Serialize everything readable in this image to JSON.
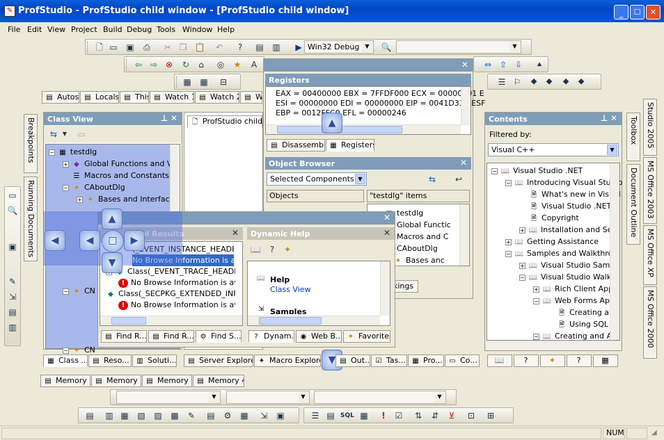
{
  "window": {
    "title": "ProfStudio - ProfStudio child window - [ProfStudio child window]",
    "controls": [
      "minimize",
      "maximize",
      "close"
    ]
  },
  "menubar": [
    "File",
    "Edit",
    "View",
    "Project",
    "Build",
    "Debug",
    "Tools",
    "Window",
    "Help"
  ],
  "toolbar": {
    "config": "Win32 Debug"
  },
  "debug_tabs": [
    "Autos",
    "Locals",
    "This",
    "Watch 1",
    "Watch 2",
    "W"
  ],
  "class_view": {
    "title": "Class View",
    "tree": [
      "testdlg",
      "Global Functions and Va",
      "Macros and Constants",
      "CAboutDlg",
      "Bases and Interface",
      "CN",
      "CN"
    ]
  },
  "doc_tab": "ProfStudio child wi",
  "registers": {
    "title": "Registers",
    "lines": [
      "EAX = 00400000 EBX = 7FFDF000 ECX = 00000001 E",
      "ESI = 00000000 EDI = 00000000 EIP = 0041D330 ESF",
      "EBP = 0012FFC0 EFL = 00000246"
    ],
    "tabs": [
      "Disassembly",
      "Registers"
    ]
  },
  "object_browser": {
    "title": "Object Browser",
    "browse": "Selected Components",
    "col1": "Objects",
    "col2": "\"testdlg\" items",
    "items": [
      "testdlg",
      "Global Functic",
      "Macros and C",
      "CAboutDlg",
      "Bases anc"
    ],
    "tab_frag": "kings"
  },
  "symbol_results": {
    "title": "ol Results",
    "items": [
      "(_EVENT_INSTANCE_HEADER) -",
      "No Browse Information is availab",
      "Class(_EVENT_TRACE_HEADER) - C:",
      "No Browse Information is availab",
      "Class(_SECPKG_EXTENDED_INFORM",
      "No Browse Information is availab"
    ],
    "tabs": [
      "Find R...",
      "Find R...",
      "Find S..."
    ]
  },
  "dynamic_help": {
    "title": "Dynamic Help",
    "heading": "Help",
    "link": "Class View",
    "next": "Samples",
    "tabs": [
      "Dynam...",
      "Web B...",
      "Favorites"
    ]
  },
  "contents": {
    "title": "Contents",
    "filter_label": "Filtered by:",
    "filter": "Visual C++",
    "tree": [
      "Visual Studio .NET",
      "Introducing Visual Studio",
      "What's new in Visual",
      "Visual Studio .NET I",
      "Copyright",
      "Installation and Set",
      "Getting Assistance",
      "Samples and Walkthro",
      "Visual Studio Sampl",
      "Visual Studio Walkt",
      "Rich Client Appl",
      "Web Forms App",
      "Creating a V",
      "Using SQL S",
      "Creating and Ac"
    ]
  },
  "right_vtabs": [
    "Studio 2005",
    "MS Office 2003",
    "MS Office XP",
    "MS Office 2000"
  ],
  "right_vtabs2": [
    "Toolbox",
    "Document Outline"
  ],
  "left_vtabs": [
    "Breakpoints",
    "Running Documents"
  ],
  "bottom_tabs_left": [
    "Class ...",
    "Reso...",
    "Soluti..."
  ],
  "bottom_tabs_mid": [
    "Server Explorer",
    "Macro Explorer"
  ],
  "bottom_tabs_right": [
    "Out...",
    "Tas...",
    "Pro...",
    "Co..."
  ],
  "memory_tabs": [
    "Memory 1",
    "Memory 2",
    "Memory 3",
    "Memory 4"
  ],
  "status": {
    "num": "NUM"
  }
}
